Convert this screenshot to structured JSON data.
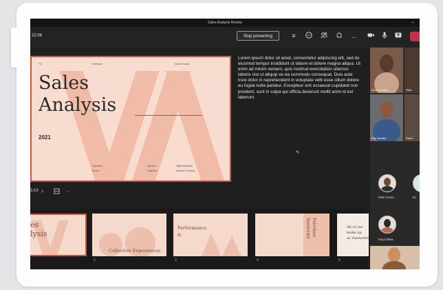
{
  "window": {
    "title": "Sales Analysis Review"
  },
  "toolbar": {
    "timer": "22:06",
    "stop_presenting": "Stop presenting",
    "more": "..."
  },
  "slide": {
    "title_line1": "Sales",
    "title_line2": "Analysis",
    "year": "2021",
    "small_texts": [
      "F/C",
      "NorthLane",
      "Sales Forecast",
      "Objectives",
      "Review",
      "Optimize",
      "Expansion",
      "Digital Marketing",
      "Customer Tracking"
    ]
  },
  "notes": {
    "text": "Lorem ipsum dolor sit amet, consectetur adipiscing elit, sed do eiusmod tempor incididunt ut labore et dolore magna aliqua. Ut enim ad minim veniam, quis nostrud exercitation ullamco laboris nisi ut aliquip ex ea commodo consequat. Duis aute irure dolor in reprehenderit in voluptate velit esse cillum dolore eu fugiat nulla pariatur. Excepteur sint occaecat cupidatat non proident, sunt in culpa qui officia deserunt mollit anim id est laborum."
  },
  "navigation": {
    "page_counter": "1/18"
  },
  "thumbnails": [
    {
      "title": "es\nlysis",
      "number": ""
    },
    {
      "title": "Collective Experiences",
      "number": "2"
    },
    {
      "title": "Performance\n&",
      "number": "3"
    },
    {
      "title": "Fabrikam\nVanArsdel",
      "number": "4"
    },
    {
      "title": "All of our\nmake up\nas VanArsdel",
      "number": "5"
    }
  ],
  "participants": [
    {
      "name": "Serena Davis"
    },
    {
      "name": "Reta"
    },
    {
      "name": "Ray Tanaka"
    },
    {
      "name": "Danie"
    },
    {
      "name": "Pete Turner"
    },
    {
      "name": "Ex"
    },
    {
      "name": "Kayo Miwa"
    }
  ],
  "colors": {
    "accent": "#c8553d",
    "slide_bg": "#f8dcd0",
    "hangup": "#c4314b"
  }
}
